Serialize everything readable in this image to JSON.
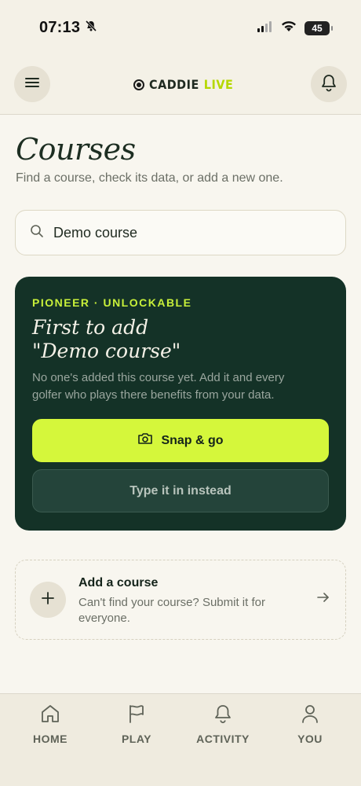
{
  "status_bar": {
    "time": "07:13",
    "battery": "45"
  },
  "header": {
    "brand_name": "CADDIE",
    "brand_live": "LIVE"
  },
  "page": {
    "title": "Courses",
    "subtitle": "Find a course, check its data, or add a new one."
  },
  "search": {
    "value": "Demo course",
    "placeholder": ""
  },
  "pioneer_card": {
    "tag": "PIONEER · UNLOCKABLE",
    "title_line1": "First to add",
    "title_line2": "\"Demo course\"",
    "description": "No one's added this course yet. Add it and every golfer who plays there benefits from your data.",
    "primary_button": "Snap & go",
    "secondary_button": "Type it in instead"
  },
  "add_course": {
    "title": "Add a course",
    "description": "Can't find your course? Submit it for everyone."
  },
  "bottom_nav": {
    "items": [
      {
        "label": "HOME",
        "icon": "home-icon"
      },
      {
        "label": "PLAY",
        "icon": "flag-icon"
      },
      {
        "label": "ACTIVITY",
        "icon": "bell-icon"
      },
      {
        "label": "YOU",
        "icon": "user-icon"
      }
    ]
  },
  "colors": {
    "background": "#f4f1e7",
    "card_dark": "#143227",
    "accent_lime": "#d5f73b",
    "tag_lime": "#c8f03a"
  }
}
